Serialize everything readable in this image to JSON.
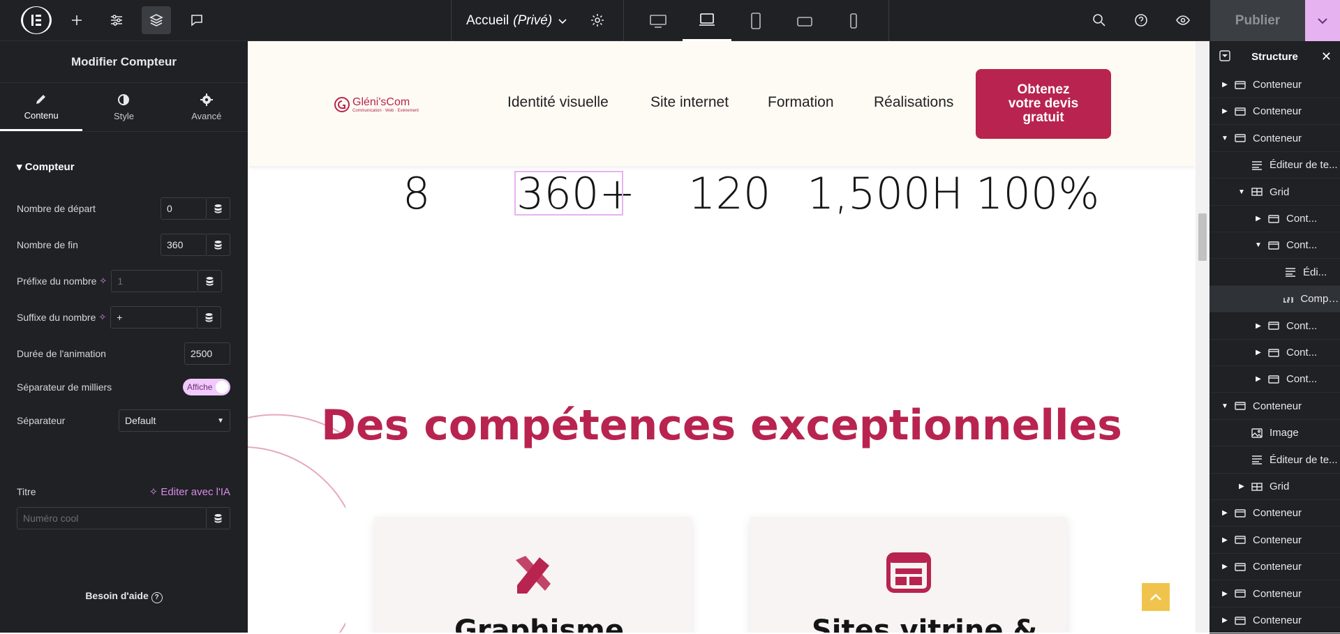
{
  "topbar": {
    "page_name": "Accueil",
    "page_status": "(Privé)",
    "publish_label": "Publier"
  },
  "left_panel": {
    "title": "Modifier Compteur",
    "tabs": [
      {
        "label": "Contenu",
        "icon": "pencil-icon"
      },
      {
        "label": "Style",
        "icon": "contrast-icon"
      },
      {
        "label": "Avancé",
        "icon": "gear-icon"
      }
    ],
    "section": "Compteur",
    "fields": {
      "start_label": "Nombre de départ",
      "start_value": "0",
      "end_label": "Nombre de fin",
      "end_value": "360",
      "prefix_label": "Préfixe du nombre",
      "prefix_placeholder": "1",
      "suffix_label": "Suffixe du nombre",
      "suffix_value": "+",
      "duration_label": "Durée de l'animation",
      "duration_value": "2500",
      "thousands_label": "Séparateur de milliers",
      "thousands_toggle": "Affiche",
      "separator_label": "Séparateur",
      "separator_value": "Default",
      "title_label": "Titre",
      "ai_edit_label": "Editer avec l'IA",
      "title_placeholder": "Numéro cool"
    },
    "help_label": "Besoin d'aide"
  },
  "canvas": {
    "brand": "Gléni'sCom",
    "brand_tagline": "Communication · Web · Evénement",
    "nav": [
      "Identité visuelle",
      "Site internet",
      "Formation",
      "Réalisations"
    ],
    "cta": [
      "Obtenez",
      "votre devis",
      "gratuit"
    ],
    "stats": [
      "8",
      "360+",
      "120",
      "1,500H",
      "100%"
    ],
    "headline": "Des compétences exceptionnelles",
    "cards": [
      "Graphisme",
      "Sites vitrine &"
    ]
  },
  "structure": {
    "title": "Structure",
    "items": [
      {
        "label": "Conteneur",
        "icon": "container-icon",
        "caret": "right"
      },
      {
        "label": "Conteneur",
        "icon": "container-icon",
        "caret": "right"
      },
      {
        "label": "Conteneur",
        "icon": "container-icon",
        "caret": "down"
      },
      {
        "label": "Éditeur de te...",
        "icon": "text-editor-icon",
        "caret": ""
      },
      {
        "label": "Grid",
        "icon": "grid-icon",
        "caret": "down"
      },
      {
        "label": "Cont...",
        "icon": "container-icon",
        "caret": "right"
      },
      {
        "label": "Cont...",
        "icon": "container-icon",
        "caret": "down"
      },
      {
        "label": "Édi...",
        "icon": "text-editor-icon",
        "caret": ""
      },
      {
        "label": "Compteur",
        "icon": "counter-icon",
        "caret": ""
      },
      {
        "label": "Cont...",
        "icon": "container-icon",
        "caret": "right"
      },
      {
        "label": "Cont...",
        "icon": "container-icon",
        "caret": "right"
      },
      {
        "label": "Cont...",
        "icon": "container-icon",
        "caret": "right"
      },
      {
        "label": "Conteneur",
        "icon": "container-icon",
        "caret": "down"
      },
      {
        "label": "Image",
        "icon": "image-icon",
        "caret": ""
      },
      {
        "label": "Éditeur de te...",
        "icon": "text-editor-icon",
        "caret": ""
      },
      {
        "label": "Grid",
        "icon": "grid-icon",
        "caret": "right"
      },
      {
        "label": "Conteneur",
        "icon": "container-icon",
        "caret": "right"
      },
      {
        "label": "Conteneur",
        "icon": "container-icon",
        "caret": "right"
      },
      {
        "label": "Conteneur",
        "icon": "container-icon",
        "caret": "right"
      },
      {
        "label": "Conteneur",
        "icon": "container-icon",
        "caret": "right"
      },
      {
        "label": "Conteneur",
        "icon": "container-icon",
        "caret": "right"
      }
    ]
  },
  "colors": {
    "brand": "#b8244f",
    "editor_dark": "#1f2124",
    "accent_pink": "#e6b3f0",
    "scroll_top": "#f0c44c"
  }
}
